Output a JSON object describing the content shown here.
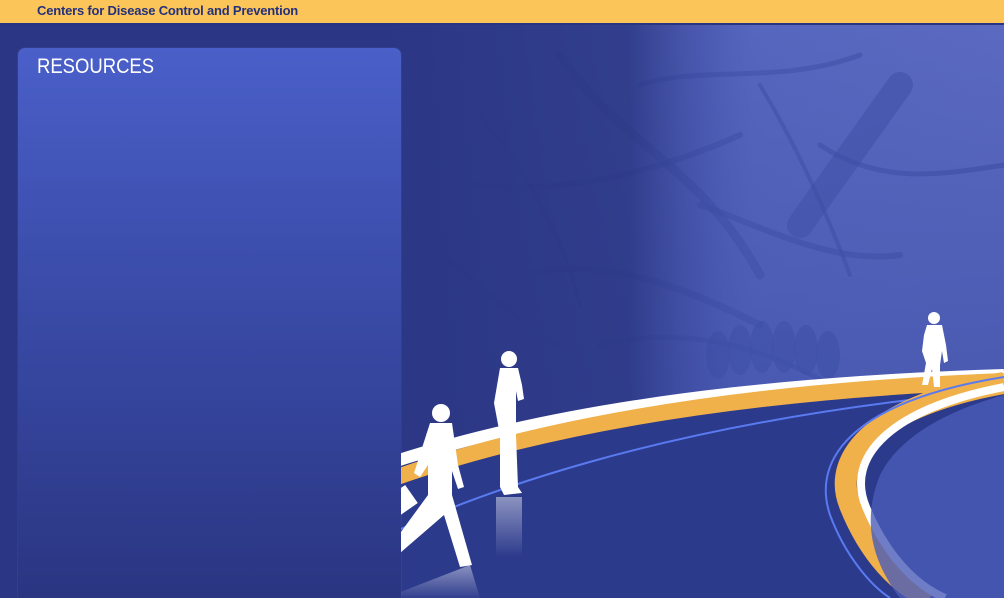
{
  "header": {
    "org_name": "Centers for Disease Control and Prevention"
  },
  "resources_panel": {
    "title": "RESOURCES"
  },
  "colors": {
    "header_bg": "#fcc55a",
    "header_text": "#24317b",
    "page_bg": "#2b3784",
    "panel_top": "#4a5fc9",
    "panel_bottom": "#2a3580",
    "road_gold": "#f0b04a",
    "road_white": "#ffffff",
    "road_blue_line": "#5a7af0"
  },
  "background_image": {
    "icon": "microscopy-mold-photo-with-people-on-curved-road"
  }
}
